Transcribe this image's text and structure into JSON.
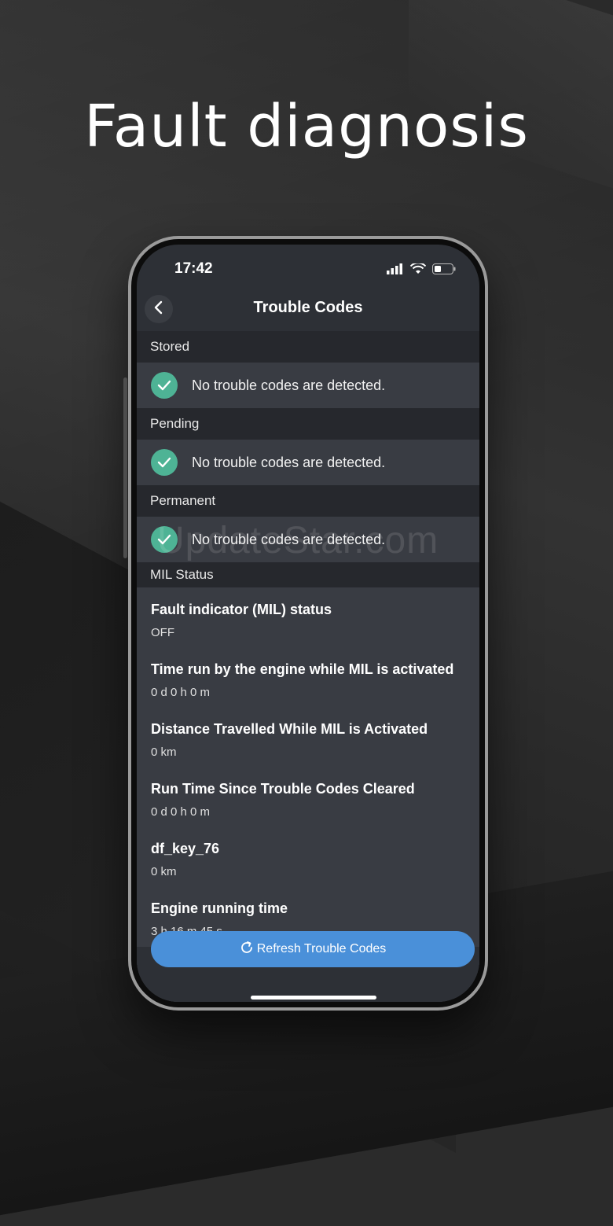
{
  "headline": "Fault diagnosis",
  "status_bar": {
    "time": "17:42"
  },
  "nav": {
    "title": "Trouble Codes"
  },
  "sections": [
    {
      "header": "Stored",
      "message": "No trouble codes are detected."
    },
    {
      "header": "Pending",
      "message": "No trouble codes are detected."
    },
    {
      "header": "Permanent",
      "message": "No trouble codes are detected."
    }
  ],
  "mil_status": {
    "header": "MIL Status",
    "items": [
      {
        "label": "Fault indicator (MIL) status",
        "value": "OFF"
      },
      {
        "label": "Time run by the engine while MIL is activated",
        "value": "0 d 0 h 0 m"
      },
      {
        "label": "Distance Travelled While MIL is Activated",
        "value": "0 km"
      },
      {
        "label": "Run Time Since Trouble Codes Cleared",
        "value": "0 d 0 h 0 m"
      },
      {
        "label": "df_key_76",
        "value": "0 km"
      },
      {
        "label": "Engine running time",
        "value": "3 h 16 m 45 s"
      }
    ]
  },
  "refresh_button": {
    "label": "Refresh Trouble Codes"
  },
  "watermark": "UpdateStar.com",
  "colors": {
    "accent": "#4a90d9",
    "check": "#4eb395"
  }
}
